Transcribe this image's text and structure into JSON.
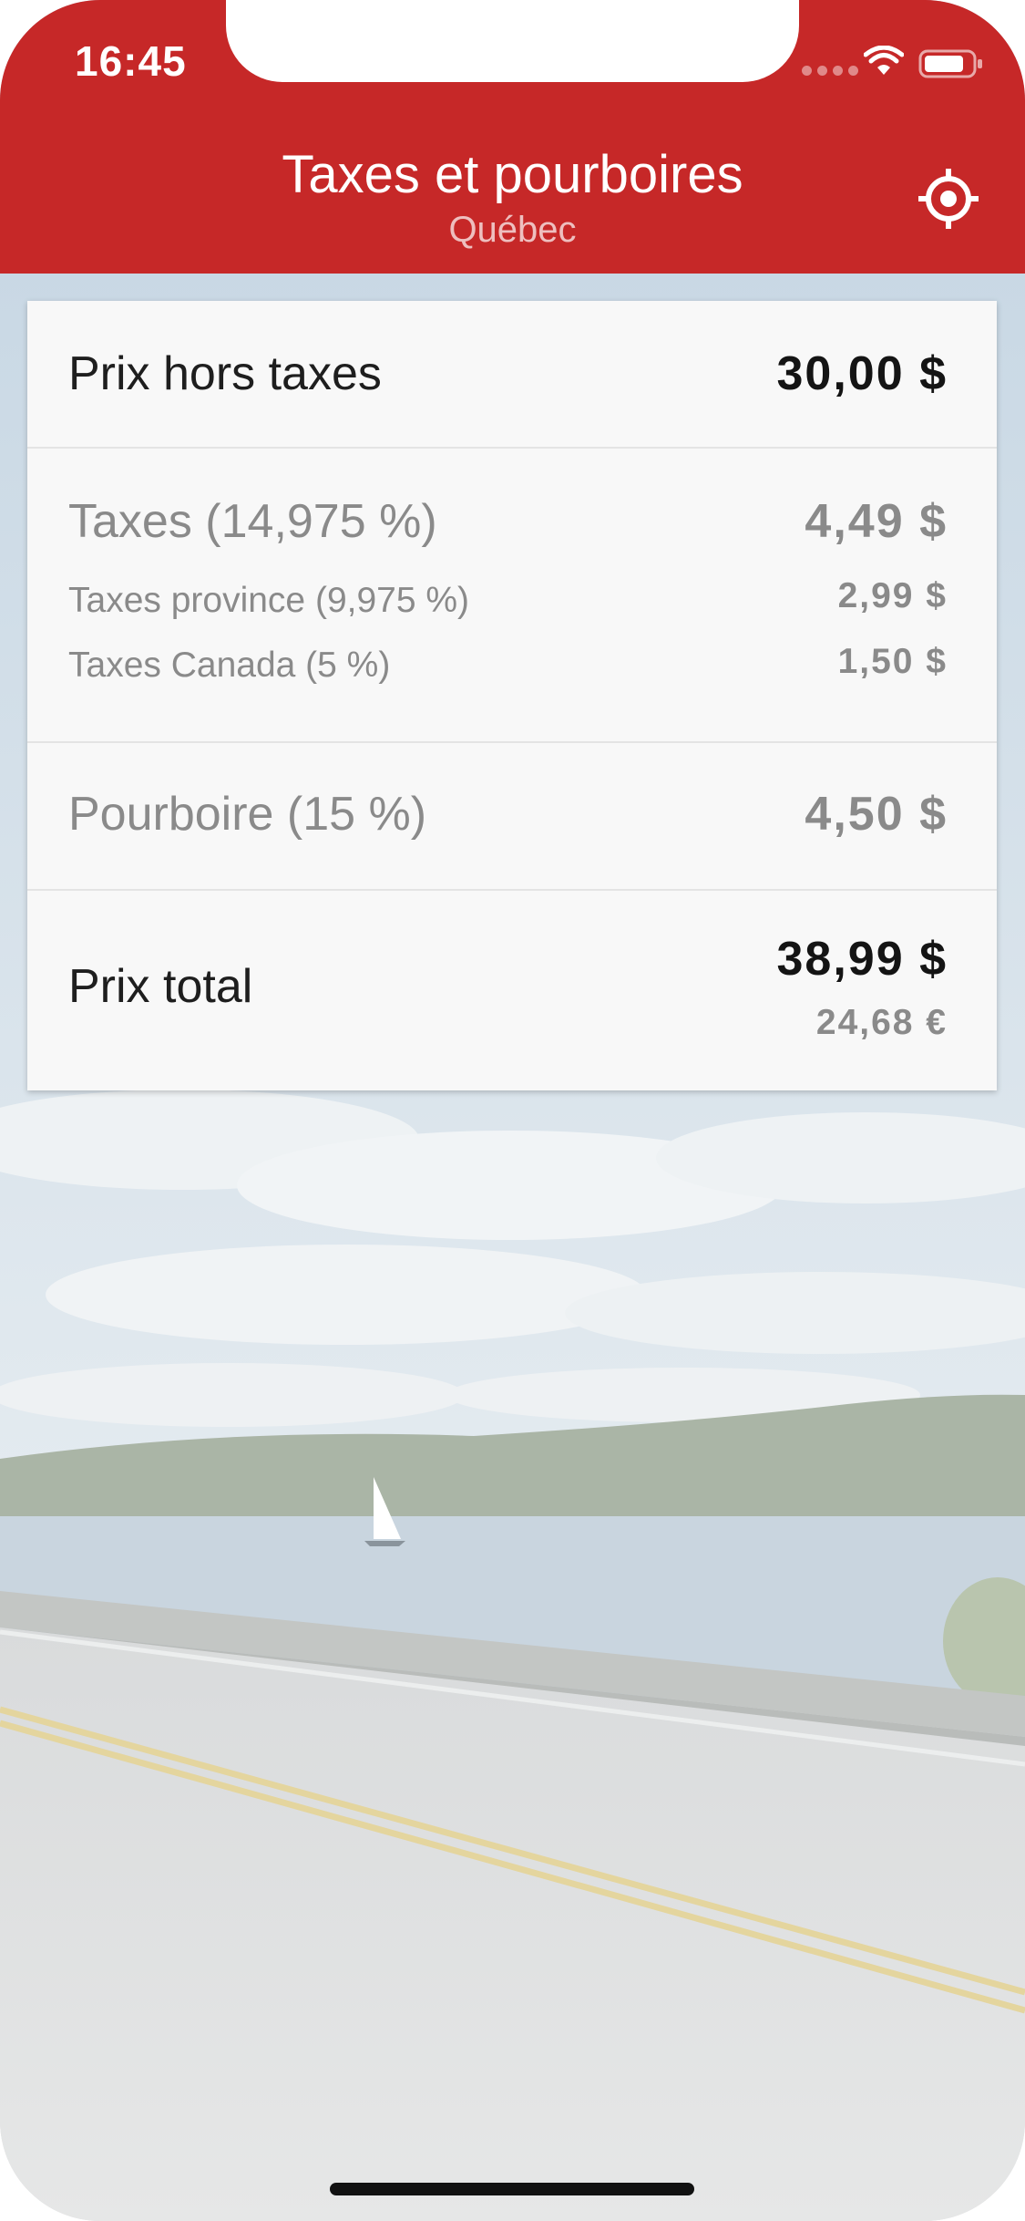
{
  "status_bar": {
    "time": "16:45"
  },
  "header": {
    "title": "Taxes et pourboires",
    "subtitle": "Québec",
    "locate_icon": "crosshair-location-icon"
  },
  "card": {
    "price_label": "Prix hors taxes",
    "price_value": "30,00 $",
    "taxes_label": "Taxes (14,975 %)",
    "taxes_value": "4,49 $",
    "province_label": "Taxes province (9,975 %)",
    "province_value": "2,99 $",
    "canada_label": "Taxes Canada (5 %)",
    "canada_value": "1,50 $",
    "tip_label": "Pourboire (15 %)",
    "tip_value": "4,50 $",
    "total_label": "Prix total",
    "total_value": "38,99 $",
    "total_euro": "24,68 €"
  },
  "colors": {
    "header": "#c62828",
    "card": "#f8f8f8"
  }
}
